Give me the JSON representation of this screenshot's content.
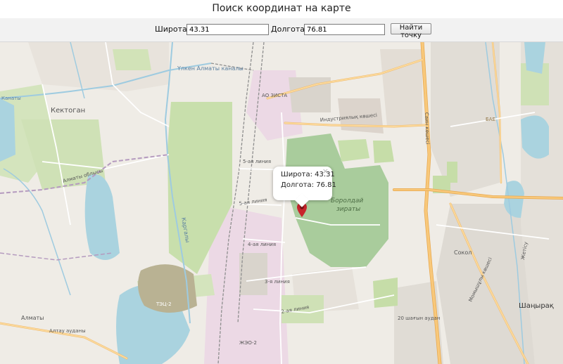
{
  "page": {
    "title": "Поиск координат на карте"
  },
  "form": {
    "lat_label": "Широта:",
    "lat_value": "43.31",
    "lng_label": "Долгота:",
    "lng_value": "76.81",
    "find_button": "Найти точку"
  },
  "popup": {
    "lat_line": "Широта: 43.31",
    "lng_line": "Долгота: 76.81",
    "close": "×"
  },
  "marker": {
    "lat": 43.31,
    "lng": 76.81,
    "icon": "map-pin-icon",
    "color": "#c8252c"
  },
  "map_labels": {
    "kektogan": "Кектоган",
    "kanaly": "Канаты",
    "ulken_almaty_kanaly": "Үлкен Алматы каналы",
    "almaty_oblysy": "Алматы облысы",
    "borolday": "Боролдай",
    "zirati": "зираты",
    "indust": "Индустриялық көшесі",
    "ao_zista": "АО ЗИСТА",
    "liniya_5a": "5-ая линия",
    "liniya_5": "5-ая линия",
    "liniya_4": "4-ая линия",
    "liniya_3": "3-я линия",
    "liniya_2": "2-ая линия",
    "almaty_road": "Алматы",
    "altay_audany": "Алтау ауданы",
    "tec2": "ТЭЦ-2",
    "zhko2": "ЖЭО-2",
    "sain": "Саин көшесі",
    "shanyrak": "Шаңырақ",
    "sokol": "Сокол",
    "raion20": "20 шағын аудан",
    "bae": "БАЕ",
    "kulzhinskiy": "Жетісу",
    "mamyrova": "Момышұлы көшесі",
    "kargaly": "Каргалы"
  },
  "colors": {
    "land": "#efece6",
    "park": "#c8dfac",
    "forest": "#b7d3a0",
    "cemetery": "#a9cc9c",
    "water": "#aad3df",
    "industrial": "#ecd9e5",
    "residential": "#e0dcd6",
    "tailings": "#b9b293",
    "road_major": "#f8c87a",
    "road_primary": "#fbd99b",
    "river": "#9ecbe0",
    "rail": "#8f8f8f"
  }
}
